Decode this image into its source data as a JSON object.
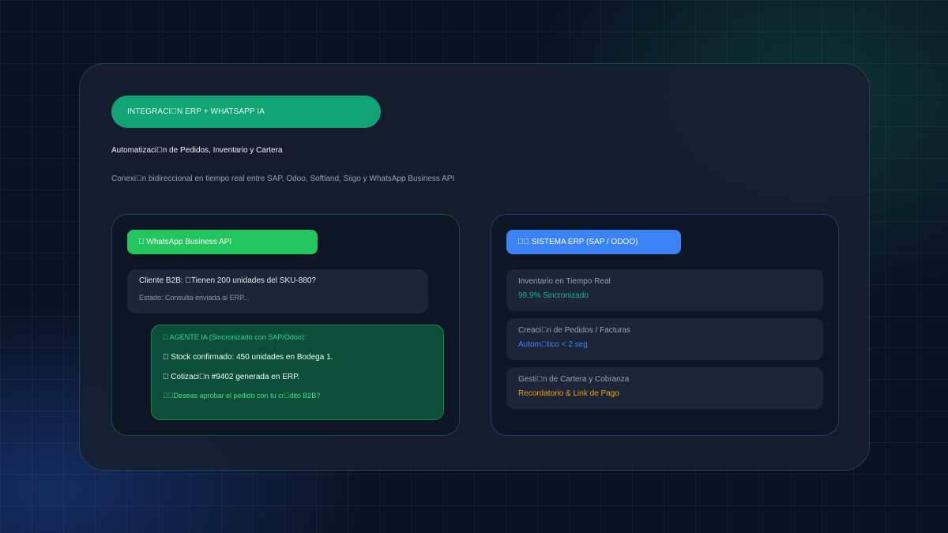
{
  "hero": {
    "badge": "INTEGRACI\u0000N ERP + WHATSAPP IA",
    "title": "Automatizaci\u0000n de Pedidos, Inventario y Cartera",
    "subtitle": "Conexi\u0000n bidireccional en tiempo real entre SAP, Odoo, Softland, Siigo y WhatsApp Business API"
  },
  "whatsapp_panel": {
    "header": "\u0000 WhatsApp Business API",
    "client_message": "Cliente B2B: \u0000Tienen 200 unidades del SKU-880?",
    "client_status": "Estado: Consulta enviada al ERP...",
    "agent": {
      "title": "\u0000 AGENTE IA (Sincronizado con SAP/Odoo):",
      "line1": "\u0000 Stock confirmado: 450 unidades en Bodega 1.",
      "line2": "\u0000 Cotizaci\u0000n #9402 generada en ERP.",
      "question": "\u0000\u0000Deseas aprobar el pedido con tu cr\u0000dito B2B?"
    }
  },
  "erp_panel": {
    "header": "\u0000\u0000 SISTEMA ERP (SAP / ODOO)",
    "rows": [
      {
        "label": "Inventario en Tiempo Real",
        "value": "99.9% Sincronizado",
        "color": "#10b981"
      },
      {
        "label": "Creaci\u0000n de Pedidos / Facturas",
        "value": "Autom\u0000tico < 2 seg",
        "color": "#3b82f6"
      },
      {
        "label": "Gesti\u0000n de Cartera y Cobranza",
        "value": "Recordatorio & Link de Pago",
        "color": "#f59e0b"
      }
    ]
  },
  "colors": {
    "accent_green": "#10a373",
    "whatsapp_green": "#22c55e",
    "erp_blue": "#3b82f6",
    "background": "#0a1222"
  }
}
